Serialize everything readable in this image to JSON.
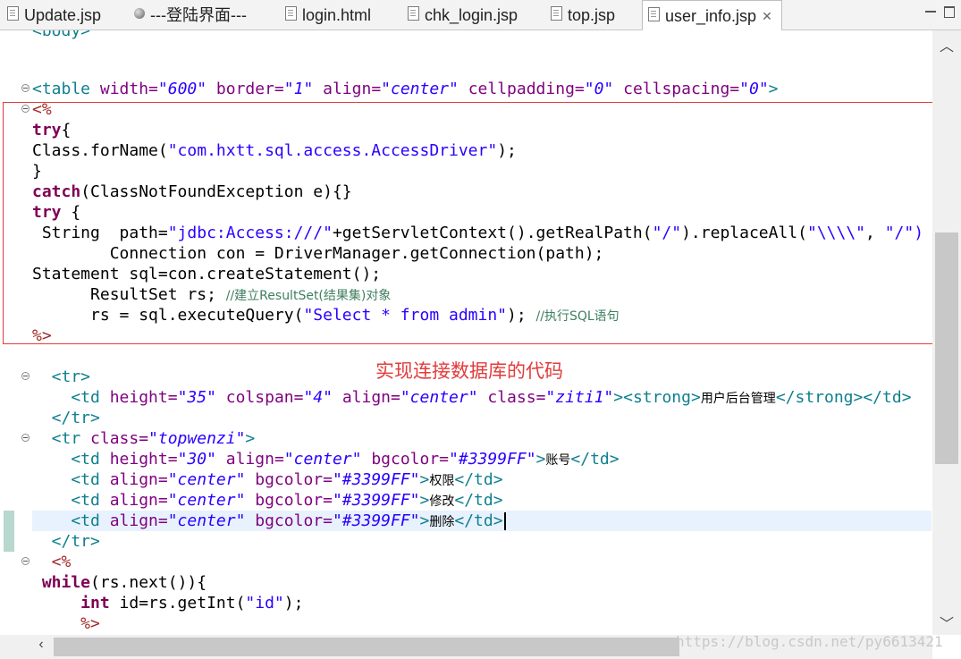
{
  "tabs": [
    {
      "label": "Update.jsp",
      "active": false,
      "icon": "file-icon"
    },
    {
      "label": "---登陆界面---",
      "active": false,
      "icon": "globe-icon"
    },
    {
      "label": "login.html",
      "active": false,
      "icon": "file-icon"
    },
    {
      "label": "chk_login.jsp",
      "active": false,
      "icon": "file-icon"
    },
    {
      "label": "top.jsp",
      "active": false,
      "icon": "file-icon"
    },
    {
      "label": "user_info.jsp",
      "active": true,
      "icon": "file-icon",
      "close": "✕"
    }
  ],
  "window_controls": {
    "minimize": "minimize-icon",
    "maximize": "maximize-icon"
  },
  "code": {
    "body_tag": "<body>",
    "table_open": {
      "tag": "<table",
      "width_attr": " width=",
      "width": "\"600\"",
      "border_attr": " border=",
      "border": "\"1\"",
      "align_attr": " align=",
      "align": "\"center\"",
      "cellpadding_attr": " cellpadding=",
      "cellpadding": "\"0\"",
      "cellspacing_attr": " cellspacing=",
      "cellspacing": "\"0\"",
      "close": ">"
    },
    "jsp_open": "<%",
    "l_try1": "try",
    "l_try1_brace": "{",
    "l_classfor_pre": "Class.forName(",
    "l_classfor_str": "\"com.hxtt.sql.access.AccessDriver\"",
    "l_classfor_post": ");",
    "l_close_brace": "}",
    "l_catch": "catch",
    "l_catch_rest": "(ClassNotFoundException e){}",
    "l_try2": "try",
    "l_try2_brace": " {",
    "l_path_pre": " String  path=",
    "l_path_str1": "\"jdbc:Access:///\"",
    "l_path_mid": "+getServletContext().getRealPath(",
    "l_path_str2": "\"/\"",
    "l_path_mid2": ").replaceAll(",
    "l_path_str3": "\"\\\\\\\\\"",
    "l_path_comma": ", ",
    "l_path_str4": "\"/\")",
    "l_conn": "        Connection con = DriverManager.getConnection(path);",
    "l_stmt": "Statement sql=con.createStatement();",
    "l_rs_decl": "      ResultSet rs; ",
    "l_rs_comment": "//建立ResultSet(结果集)对象",
    "l_rs_exec_pre": "      rs = sql.executeQuery(",
    "l_rs_exec_str": "\"Select * from admin\"",
    "l_rs_exec_post": "); ",
    "l_rs_exec_comment": "//执行SQL语句",
    "jsp_close": "%>",
    "tr_open": "  <tr>",
    "td1": {
      "pre": "    <td",
      "height_attr": " height=",
      "height": "\"35\"",
      "colspan_attr": " colspan=",
      "colspan": "\"4\"",
      "align_attr": " align=",
      "align": "\"center\"",
      "class_attr": " class=",
      "class": "\"ziti1\"",
      "strong_open": "><strong>",
      "text": "用户后台管理",
      "strong_close": "</strong></td>"
    },
    "tr_close": "  </tr>",
    "tr2_open": {
      "pre": "  <tr",
      "class_attr": " class=",
      "class": "\"topwenzi\"",
      "close": ">"
    },
    "td_account": {
      "pre": "    <td",
      "height_attr": " height=",
      "height": "\"30\"",
      "align_attr": " align=",
      "align": "\"center\"",
      "bg_attr": " bgcolor=",
      "bg": "\"#3399FF\"",
      "close": ">",
      "text": "账号",
      "end": "</td>"
    },
    "td_perm": {
      "pre": "    <td",
      "align_attr": " align=",
      "align": "\"center\"",
      "bg_attr": " bgcolor=",
      "bg": "\"#3399FF\"",
      "close": ">",
      "text": "权限",
      "end": "</td>"
    },
    "td_edit": {
      "pre": "    <td",
      "align_attr": " align=",
      "align": "\"center\"",
      "bg_attr": " bgcolor=",
      "bg": "\"#3399FF\"",
      "close": ">",
      "text": "修改",
      "end": "</td>"
    },
    "td_del": {
      "pre": "    <td",
      "align_attr": " align=",
      "align": "\"center\"",
      "bg_attr": " bgcolor=",
      "bg": "\"#3399FF\"",
      "close": ">",
      "text": "删除",
      "end": "</td>"
    },
    "tr2_close": "  </tr>",
    "jsp_open2": "  <%",
    "l_while": " while",
    "l_while_rest": "(rs.next()){",
    "l_int": "     int",
    "l_int_rest": " id=rs.getInt(",
    "l_int_str": "\"id\"",
    "l_int_post": ");",
    "jsp_close2": "     %>"
  },
  "annotation": "实现连接数据库的代码",
  "watermark": "https://blog.csdn.net/py6613421",
  "colors": {
    "keyword": "#7f0055",
    "string": "#2a00ff",
    "tag": "#0f7f8f",
    "attribute": "#7f007f",
    "comment": "#3f7f5f",
    "annotation": "#e23b3b",
    "current_line": "#e8f2fe"
  }
}
